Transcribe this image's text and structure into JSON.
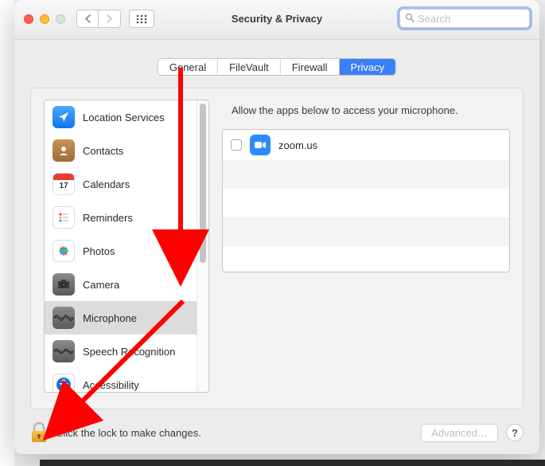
{
  "window": {
    "title": "Security & Privacy"
  },
  "search": {
    "placeholder": "Search"
  },
  "tabs": [
    {
      "label": "General",
      "selected": false
    },
    {
      "label": "FileVault",
      "selected": false
    },
    {
      "label": "Firewall",
      "selected": false
    },
    {
      "label": "Privacy",
      "selected": true
    }
  ],
  "privacy": {
    "heading": "Allow the apps below to access your microphone.",
    "categories": [
      {
        "label": "Location Services",
        "icon": "location",
        "selected": false
      },
      {
        "label": "Contacts",
        "icon": "contacts",
        "selected": false
      },
      {
        "label": "Calendars",
        "icon": "calendar",
        "selected": false
      },
      {
        "label": "Reminders",
        "icon": "reminders",
        "selected": false
      },
      {
        "label": "Photos",
        "icon": "photos",
        "selected": false
      },
      {
        "label": "Camera",
        "icon": "camera",
        "selected": false
      },
      {
        "label": "Microphone",
        "icon": "microphone",
        "selected": true
      },
      {
        "label": "Speech Recognition",
        "icon": "speech",
        "selected": false
      },
      {
        "label": "Accessibility",
        "icon": "accessibility",
        "selected": false
      }
    ],
    "apps": [
      {
        "label": "zoom.us",
        "checked": false,
        "icon": "zoom"
      }
    ]
  },
  "footer": {
    "lock_text": "Click the lock to make changes.",
    "advanced_label": "Advanced…",
    "help_label": "?"
  }
}
